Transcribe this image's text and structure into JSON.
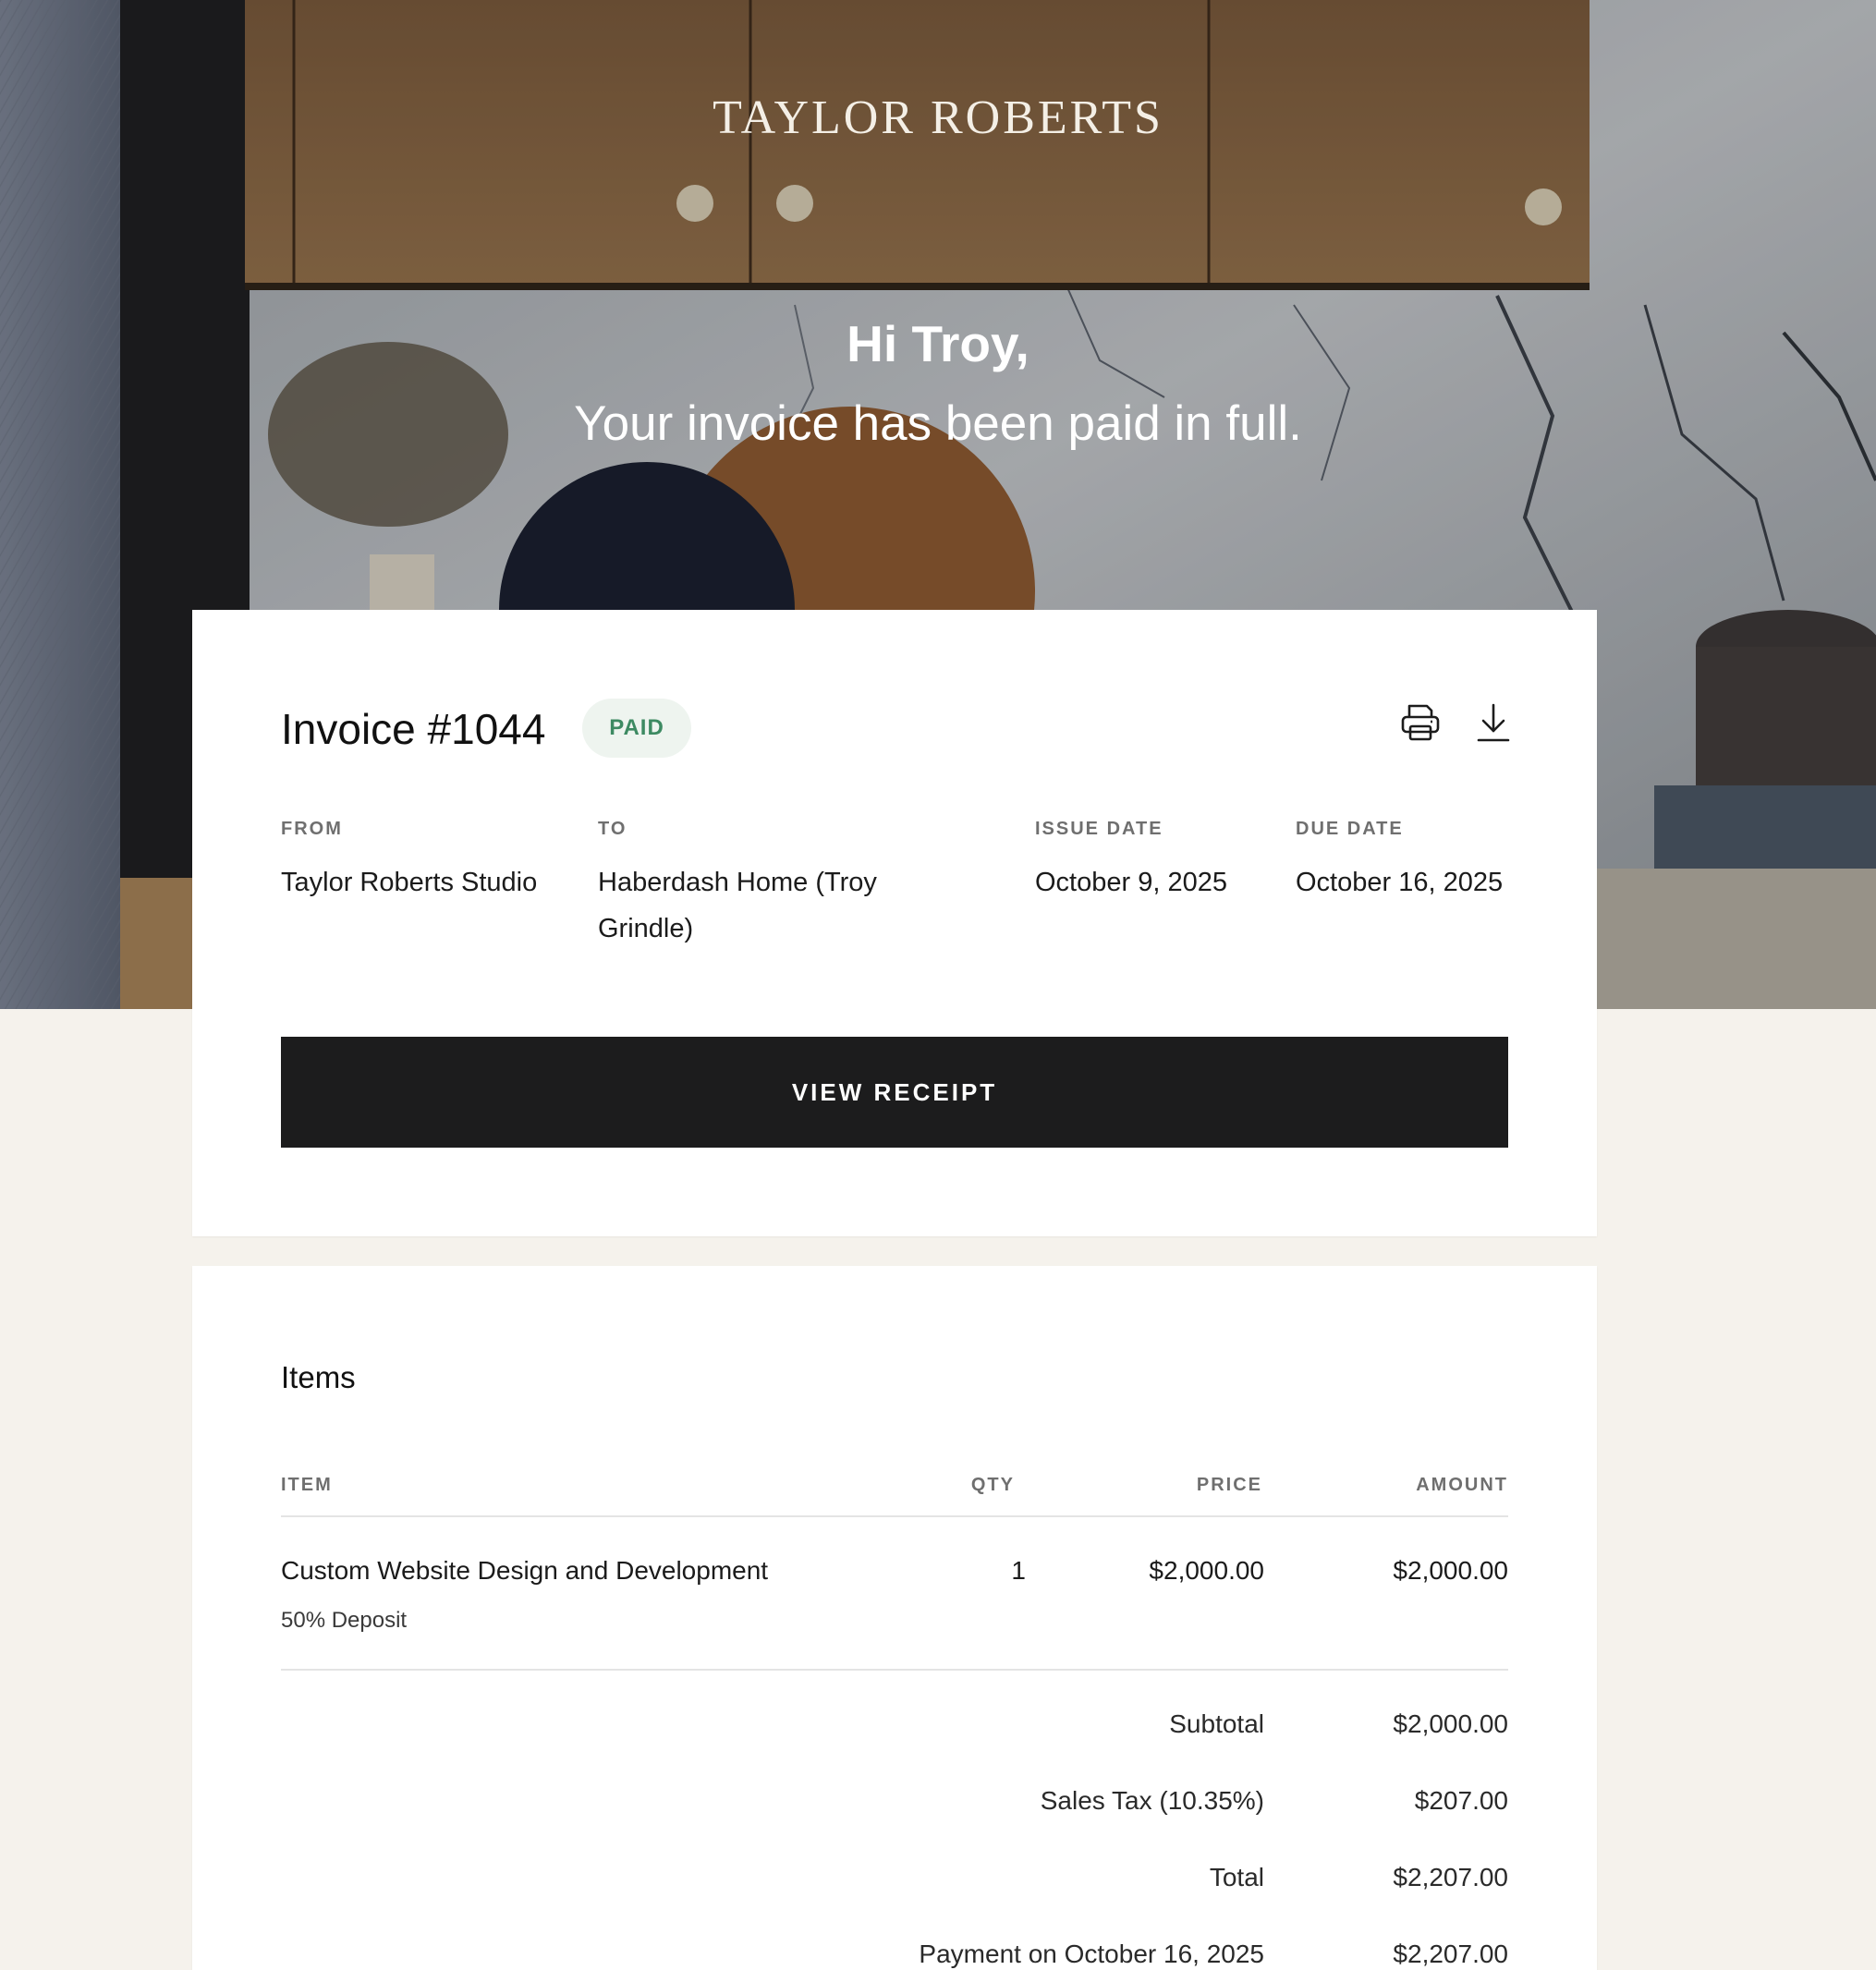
{
  "brand": "TAYLOR ROBERTS",
  "hero": {
    "greeting": "Hi Troy,",
    "headline": "Your invoice has been paid in full."
  },
  "invoice": {
    "title": "Invoice #1044",
    "status": "PAID",
    "status_color": "#3d8a62",
    "actions": {
      "print_icon": "printer-icon",
      "download_icon": "download-icon"
    },
    "from": {
      "label": "FROM",
      "value": "Taylor Roberts Studio"
    },
    "to": {
      "label": "TO",
      "value_line1": "Haberdash Home (Troy",
      "value_line2": "Grindle)"
    },
    "issue_date": {
      "label": "ISSUE DATE",
      "value": "October 9, 2025"
    },
    "due_date": {
      "label": "DUE DATE",
      "value": "October 16, 2025"
    },
    "button_label": "VIEW RECEIPT"
  },
  "items": {
    "title": "Items",
    "headers": {
      "item": "ITEM",
      "qty": "QTY",
      "price": "PRICE",
      "amount": "AMOUNT"
    },
    "rows": [
      {
        "name": "Custom Website Design and Development",
        "description": "50% Deposit",
        "qty": "1",
        "price": "$2,000.00",
        "amount": "$2,000.00"
      }
    ],
    "totals": [
      {
        "label": "Subtotal",
        "value": "$2,000.00"
      },
      {
        "label": "Sales Tax (10.35%)",
        "value": "$207.00"
      },
      {
        "label": "Total",
        "value": "$2,207.00"
      },
      {
        "label": "Payment on October 16, 2025",
        "value": "$2,207.00"
      }
    ]
  },
  "colors": {
    "page_bg": "#f5f2ec",
    "button_bg": "#1c1c1d",
    "badge_bg": "#eef4ef"
  }
}
